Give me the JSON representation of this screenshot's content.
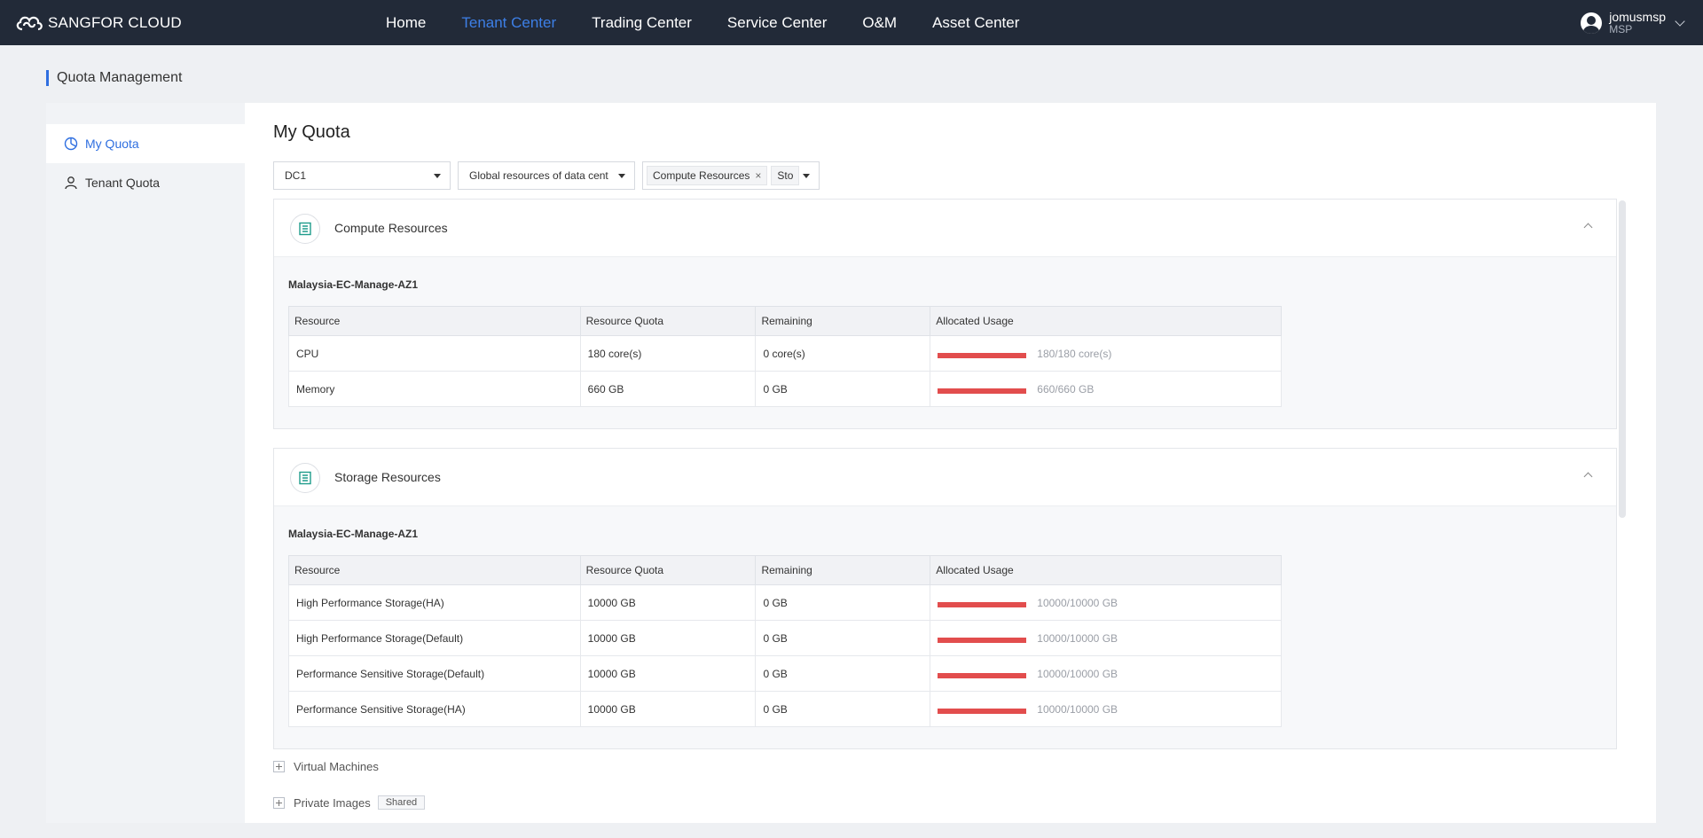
{
  "brand": {
    "name": "SANGFOR CLOUD"
  },
  "nav": {
    "items": [
      {
        "label": "Home",
        "active": false
      },
      {
        "label": "Tenant Center",
        "active": true
      },
      {
        "label": "Trading Center",
        "active": false
      },
      {
        "label": "Service Center",
        "active": false
      },
      {
        "label": "O&M",
        "active": false
      },
      {
        "label": "Asset Center",
        "active": false
      }
    ]
  },
  "user": {
    "name": "jomusmsp",
    "role": "MSP"
  },
  "page": {
    "title": "Quota Management"
  },
  "sidebar": {
    "items": [
      {
        "label": "My Quota",
        "icon": "quota-icon",
        "active": true
      },
      {
        "label": "Tenant Quota",
        "icon": "user-icon",
        "active": false
      }
    ]
  },
  "content": {
    "title": "My Quota"
  },
  "filters": {
    "datacenter": "DC1",
    "scope": "Global resources of data cent",
    "tags": [
      "Compute Resources",
      "Sto"
    ]
  },
  "compute": {
    "title": "Compute Resources",
    "az": "Malaysia-EC-Manage-AZ1",
    "headers": [
      "Resource",
      "Resource Quota",
      "Remaining",
      "Allocated Usage"
    ],
    "rows": [
      {
        "resource": "CPU",
        "quota": "180 core(s)",
        "remaining": "0 core(s)",
        "usage": "180/180 core(s)",
        "fraction": 1.0
      },
      {
        "resource": "Memory",
        "quota": "660 GB",
        "remaining": "0 GB",
        "usage": "660/660 GB",
        "fraction": 1.0
      }
    ]
  },
  "storage": {
    "title": "Storage Resources",
    "az": "Malaysia-EC-Manage-AZ1",
    "headers": [
      "Resource",
      "Resource Quota",
      "Remaining",
      "Allocated Usage"
    ],
    "rows": [
      {
        "resource": "High Performance Storage(HA)",
        "quota": "10000 GB",
        "remaining": "0 GB",
        "usage": "10000/10000 GB",
        "fraction": 1.0
      },
      {
        "resource": "High Performance Storage(Default)",
        "quota": "10000 GB",
        "remaining": "0 GB",
        "usage": "10000/10000 GB",
        "fraction": 1.0
      },
      {
        "resource": "Performance Sensitive Storage(Default)",
        "quota": "10000 GB",
        "remaining": "0 GB",
        "usage": "10000/10000 GB",
        "fraction": 1.0
      },
      {
        "resource": "Performance Sensitive Storage(HA)",
        "quota": "10000 GB",
        "remaining": "0 GB",
        "usage": "10000/10000 GB",
        "fraction": 1.0
      }
    ]
  },
  "collapsed_sections": [
    {
      "label": "Virtual Machines",
      "badge": ""
    },
    {
      "label": "Private Images",
      "badge": "Shared"
    }
  ],
  "colors": {
    "accent": "#2f6fe0",
    "usage_bar": "#e24d4d",
    "topbar": "#222a38"
  }
}
